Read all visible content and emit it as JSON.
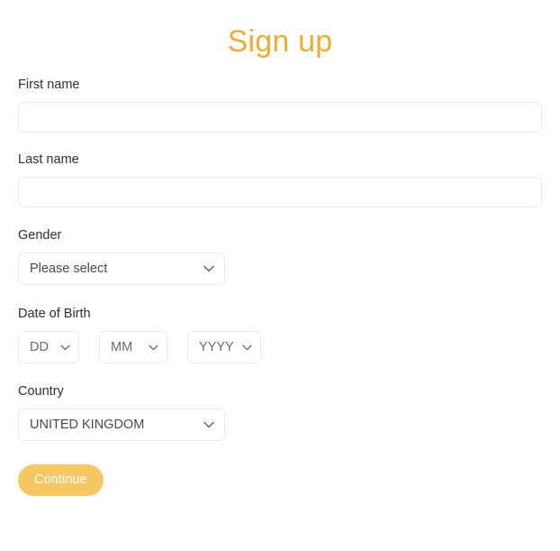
{
  "header": {
    "title": "Sign up",
    "title_color": "#eeab36"
  },
  "theme": {
    "accent": "#eeab36",
    "button_bg": "#f5c863",
    "button_text": "#ffffff",
    "border": "#ececec",
    "label_color": "#2f2f2f",
    "value_color": "#4a4a4a",
    "placeholder_color": "#6a6a6a",
    "background": "#ffffff"
  },
  "form": {
    "first_name": {
      "label": "First name",
      "value": "",
      "placeholder": ""
    },
    "last_name": {
      "label": "Last name",
      "value": "",
      "placeholder": ""
    },
    "gender": {
      "label": "Gender",
      "selected": "Please select",
      "icon": "chevron-down-icon"
    },
    "date_of_birth": {
      "label": "Date of Birth",
      "day": {
        "selected": "DD",
        "icon": "chevron-down-icon"
      },
      "month": {
        "selected": "MM",
        "icon": "chevron-down-icon"
      },
      "year": {
        "selected": "YYYY",
        "icon": "chevron-down-icon"
      }
    },
    "country": {
      "label": "Country",
      "selected": "UNITED KINGDOM",
      "icon": "chevron-down-icon"
    },
    "submit": {
      "label": "Continue"
    }
  }
}
